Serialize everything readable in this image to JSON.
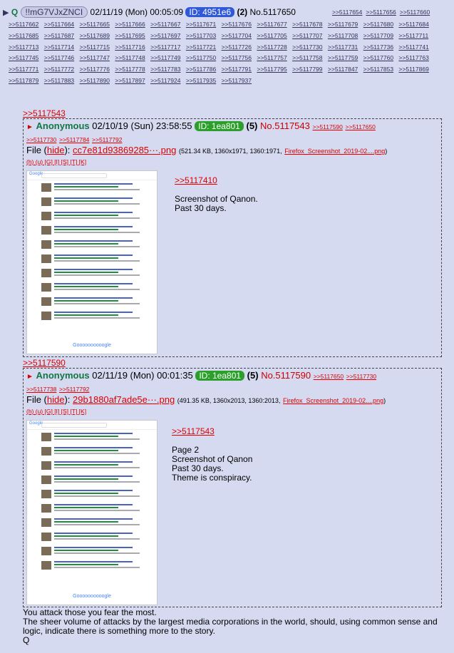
{
  "header": {
    "tripcode": "!!mG7VJxZNCI",
    "date": "02/11/19 (Mon) 00:05:09",
    "id": "ID: 4951e6",
    "count": "(2)",
    "no": "No.5117650",
    "name_initial": "Q",
    "replies": [
      ">>5117654",
      ">>5117656",
      ">>5117660",
      ">>5117662",
      ">>5117664",
      ">>5117665",
      ">>5117666",
      ">>5117667",
      ">>5117671",
      ">>5117676",
      ">>5117677",
      ">>5117678",
      ">>5117679",
      ">>5117680",
      ">>5117684",
      ">>5117685",
      ">>5117687",
      ">>5117689",
      ">>5117695",
      ">>5117697",
      ">>5117703",
      ">>5117704",
      ">>5117705",
      ">>5117707",
      ">>5117708",
      ">>5117709",
      ">>5117711",
      ">>5117713",
      ">>5117714",
      ">>5117715",
      ">>5117716",
      ">>5117717",
      ">>5117721",
      ">>5117726",
      ">>5117728",
      ">>5117730",
      ">>5117731",
      ">>5117736",
      ">>5117741",
      ">>5117745",
      ">>5117746",
      ">>5117747",
      ">>5117748",
      ">>5117749",
      ">>5117750",
      ">>5117756",
      ">>5117757",
      ">>5117758",
      ">>5117759",
      ">>5117760",
      ">>5117763",
      ">>5117771",
      ">>5117772",
      ">>5117776",
      ">>5117778",
      ">>5117783",
      ">>5117786",
      ">>5117791",
      ">>5117795",
      ">>5117799",
      ">>5117847",
      ">>5117853",
      ">>5117869",
      ">>5117879",
      ">>5117883",
      ">>5117890",
      ">>5117897",
      ">>5117924",
      ">>5117935",
      ">>5117937"
    ]
  },
  "post1": {
    "quote_above": ">>5117543",
    "name": "Anonymous",
    "date": "02/10/19 (Sun) 23:58:55",
    "id": "ID: 1ea801",
    "count": "(5)",
    "no": "No.5117543",
    "replies_a": ">>5117590",
    "replies_b": ">>5117650",
    "replies_c": ">>5117730",
    "replies_d": ">>5117784",
    "replies_e": ">>5117792",
    "file_label": "File (",
    "hide": "hide",
    "file_mid": "):",
    "filename": "cc7e81d93869285···.png",
    "fileinfo": "(521.34 KB, 1360x1971, 1360:1971,",
    "origname": "Firefox_Screenshot_2019-02....png",
    "fileinfo_end": ")",
    "tools": "(h) (u) [G] [I] [S] [T] [K]",
    "text_quote": ">>5117410",
    "text1": "Screenshot of Qanon.",
    "text2": "Past 30 days."
  },
  "post2": {
    "quote_above": ">>5117590",
    "name": "Anonymous",
    "date": "02/11/19 (Mon) 00:01:35",
    "id": "ID: 1ea801",
    "count": "(5)",
    "no": "No.5117590",
    "replies_a": ">>5117650",
    "replies_b": ">>5117730",
    "replies_c": ">>5117738",
    "replies_d": ">>5117792",
    "file_label": "File (",
    "hide": "hide",
    "file_mid": "):",
    "filename": "29b1880af7ade5e···.png",
    "fileinfo": "(491.35 KB, 1360x2013, 1360:2013,",
    "origname": "Firefox_Screenshot_2019-02....png",
    "fileinfo_end": ")",
    "tools": "(h) (u) [G] [I] [S] [T] [K]",
    "text_quote": ">>5117543",
    "text1": "Page 2",
    "text2": "Screenshot of Qanon",
    "text3": "Past 30 days.",
    "text4": "Theme is conspiracy."
  },
  "body": {
    "line1": "You attack those you fear the most.",
    "line2": "The sheer volume of attacks by the largest media corporations in the world, should, using common sense and logic, indicate there is something more to the story.",
    "line3": "Q"
  },
  "thumb_text": {
    "logo": "Google",
    "footer": "Goooooooooogle"
  }
}
